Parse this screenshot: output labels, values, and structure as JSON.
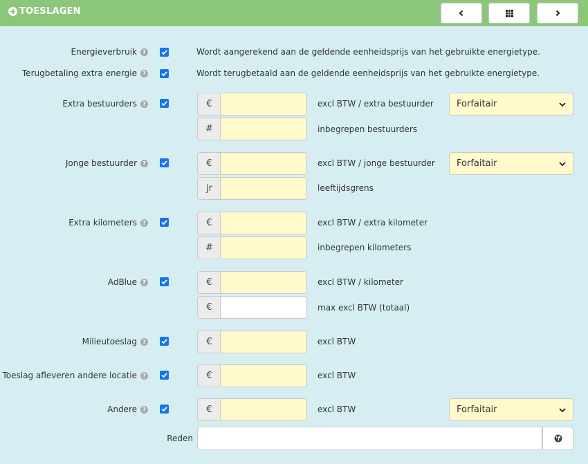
{
  "header": {
    "title": "TOESLAGEN",
    "prev_icon": "chevron-left-icon",
    "grid_icon": "grid-icon",
    "next_icon": "chevron-right-icon"
  },
  "rows": {
    "energieverbruik": {
      "label": "Energieverbruik",
      "checked": true,
      "desc": "Wordt aangerekend aan de geldende eenheidsprijs van het gebruikte energietype."
    },
    "terugbetaling": {
      "label": "Terugbetaling extra energie",
      "checked": true,
      "desc": "Wordt terugbetaald aan de geldende eenheidsprijs van het gebruikte energietype."
    },
    "extra_bestuurders": {
      "label": "Extra bestuurders",
      "checked": true,
      "price_addon": "€",
      "price_value": "",
      "price_suffix": "excl BTW / extra bestuurder",
      "count_addon": "#",
      "count_value": "",
      "count_suffix": "inbegrepen bestuurders",
      "mode": "Forfaitair"
    },
    "jonge_bestuurder": {
      "label": "Jonge bestuurder",
      "checked": true,
      "price_addon": "€",
      "price_value": "",
      "price_suffix": "excl BTW / jonge bestuurder",
      "age_addon": "jr",
      "age_value": "",
      "age_suffix": "leeftijdsgrens",
      "mode": "Forfaitair"
    },
    "extra_kilometers": {
      "label": "Extra kilometers",
      "checked": true,
      "price_addon": "€",
      "price_value": "",
      "price_suffix": "excl BTW / extra kilometer",
      "count_addon": "#",
      "count_value": "",
      "count_suffix": "inbegrepen kilometers"
    },
    "adblue": {
      "label": "AdBlue",
      "checked": true,
      "price_addon": "€",
      "price_value": "",
      "price_suffix": "excl BTW / kilometer",
      "max_addon": "€",
      "max_value": "",
      "max_suffix": "max excl BTW (totaal)"
    },
    "milieutoeslag": {
      "label": "Milieutoeslag",
      "checked": true,
      "price_addon": "€",
      "price_value": "",
      "price_suffix": "excl BTW"
    },
    "afleveren": {
      "label": "Toeslag afleveren andere locatie",
      "checked": true,
      "price_addon": "€",
      "price_value": "",
      "price_suffix": "excl BTW"
    },
    "andere": {
      "label": "Andere",
      "checked": true,
      "price_addon": "€",
      "price_value": "",
      "price_suffix": "excl BTW",
      "mode": "Forfaitair"
    }
  },
  "reden": {
    "label": "Reden",
    "value": "",
    "globe_icon": "globe-icon"
  },
  "help_icon": "question-circle-icon",
  "colors": {
    "header": "#8cc67b",
    "background": "#d6eef2",
    "input_fill": "#fff9cc",
    "checkbox": "#1a73e8"
  }
}
